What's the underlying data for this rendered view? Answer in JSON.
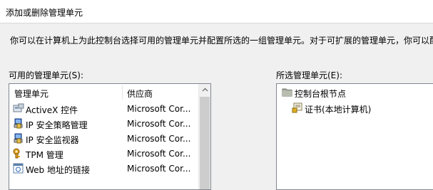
{
  "window": {
    "title": "添加或删除管理单元"
  },
  "description": "你可以在计算机上为此控制台选择可用的管理单元并配置所选的一组管理单元。对于可扩展的管理单元，你可以配",
  "available": {
    "label": "可用的管理单元(S):",
    "columns": {
      "name": "管理单元",
      "vendor": "供应商"
    },
    "rows": [
      {
        "name": "ActiveX 控件",
        "vendor": "Microsoft Cor...",
        "icon": "activex-control-icon"
      },
      {
        "name": "IP 安全策略管理",
        "vendor": "Microsoft Cor...",
        "icon": "ip-security-policy-icon"
      },
      {
        "name": "IP 安全监视器",
        "vendor": "Microsoft Cor...",
        "icon": "ip-security-monitor-icon"
      },
      {
        "name": "TPM 管理",
        "vendor": "Microsoft Cor...",
        "icon": "tpm-key-icon"
      },
      {
        "name": "Web 地址的链接",
        "vendor": "Microsoft Cor...",
        "icon": "web-link-icon"
      }
    ]
  },
  "selected": {
    "label": "所选管理单元(E):",
    "root": "控制台根节点",
    "child": "证书(本地计算机)"
  },
  "colors": {
    "background": "#f0f0f0",
    "list_border": "#828790",
    "scroll_thumb": "#cdcdcd"
  }
}
